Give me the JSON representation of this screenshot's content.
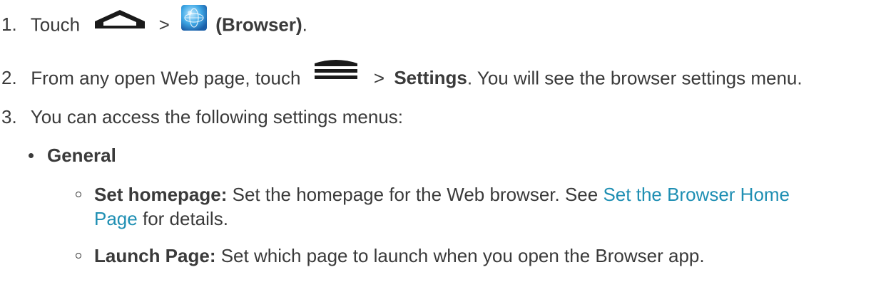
{
  "steps": [
    {
      "number": "1.",
      "text_before": "Touch",
      "separator": ">",
      "bold": "(Browser)",
      "text_after": ".",
      "icons": [
        "home-icon",
        "browser-globe-icon"
      ]
    },
    {
      "number": "2.",
      "text_before": "From any open Web page, touch",
      "separator": ">",
      "bold": "Settings",
      "text_after": ". You will see the browser settings menu.",
      "icons": [
        "menu-icon"
      ]
    },
    {
      "number": "3.",
      "text": "You can access the following settings menus:"
    }
  ],
  "menus": {
    "heading": "General",
    "items": [
      {
        "label": "Set homepage:",
        "text": "Set the homepage for the Web browser. See",
        "link_line1": "Set the Browser Home",
        "link_line2": "Page",
        "text_after": "for details."
      },
      {
        "label": "Launch Page:",
        "text": "Set which page to launch when you open the Browser app."
      }
    ]
  },
  "colors": {
    "text": "#3a3a3a",
    "link": "#1f8fb3"
  }
}
